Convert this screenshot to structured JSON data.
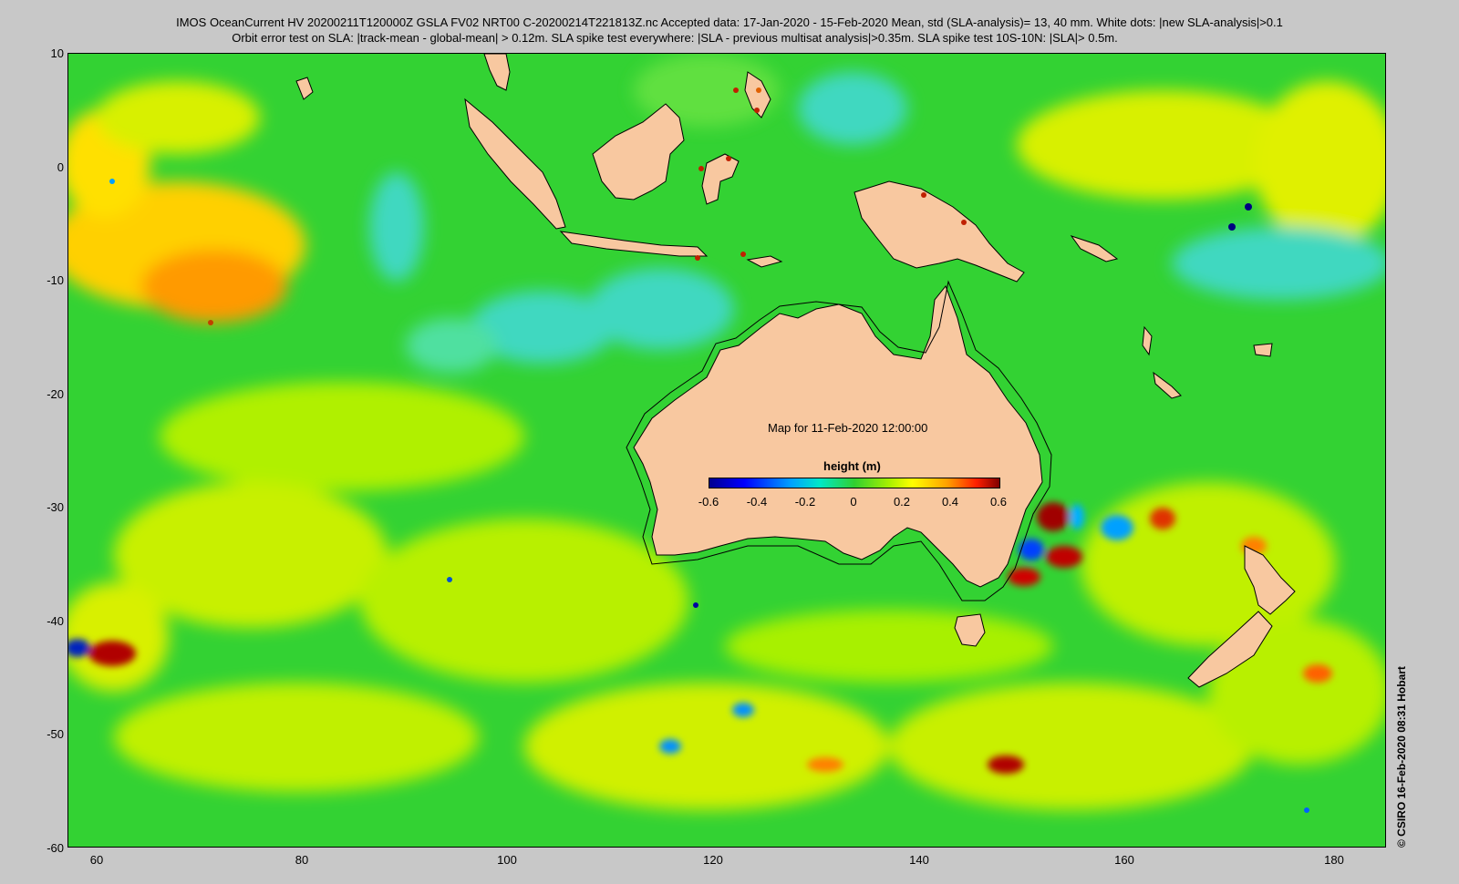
{
  "header": {
    "line1": "IMOS OceanCurrent HV 20200211T120000Z GSLA FV02 NRT00 C-20200214T221813Z.nc  Accepted data: 17-Jan-2020 - 15-Feb-2020 Mean, std (SLA-analysis)= 13, 40 mm. White dots: |new SLA-analysis|>0.1",
    "line2": "Orbit error test on SLA: |track-mean  - global-mean| > 0.12m.  SLA spike test everywhere: |SLA - previous multisat analysis|>0.35m. SLA spike test 10S-10N: |SLA|> 0.5m."
  },
  "map": {
    "panel_title": "Map for 11-Feb-2020 12:00:00",
    "lon_range": [
      57,
      185
    ],
    "lat_range": [
      -60,
      10
    ],
    "lat_ticks": [
      "10",
      "0",
      "-10",
      "-20",
      "-30",
      "-40",
      "-50",
      "-60"
    ],
    "lon_ticks": [
      "60",
      "80",
      "100",
      "120",
      "140",
      "160",
      "180"
    ],
    "background_color": "#33d233",
    "land_color": "#f8c8a0"
  },
  "colorbar": {
    "title": "height (m)",
    "ticks": [
      "-0.6",
      "-0.4",
      "-0.2",
      "0",
      "0.2",
      "0.4",
      "0.6"
    ],
    "range": [
      -0.6,
      0.6
    ]
  },
  "credit": "© CSIRO 16-Feb-2020 08:31 Hobart"
}
